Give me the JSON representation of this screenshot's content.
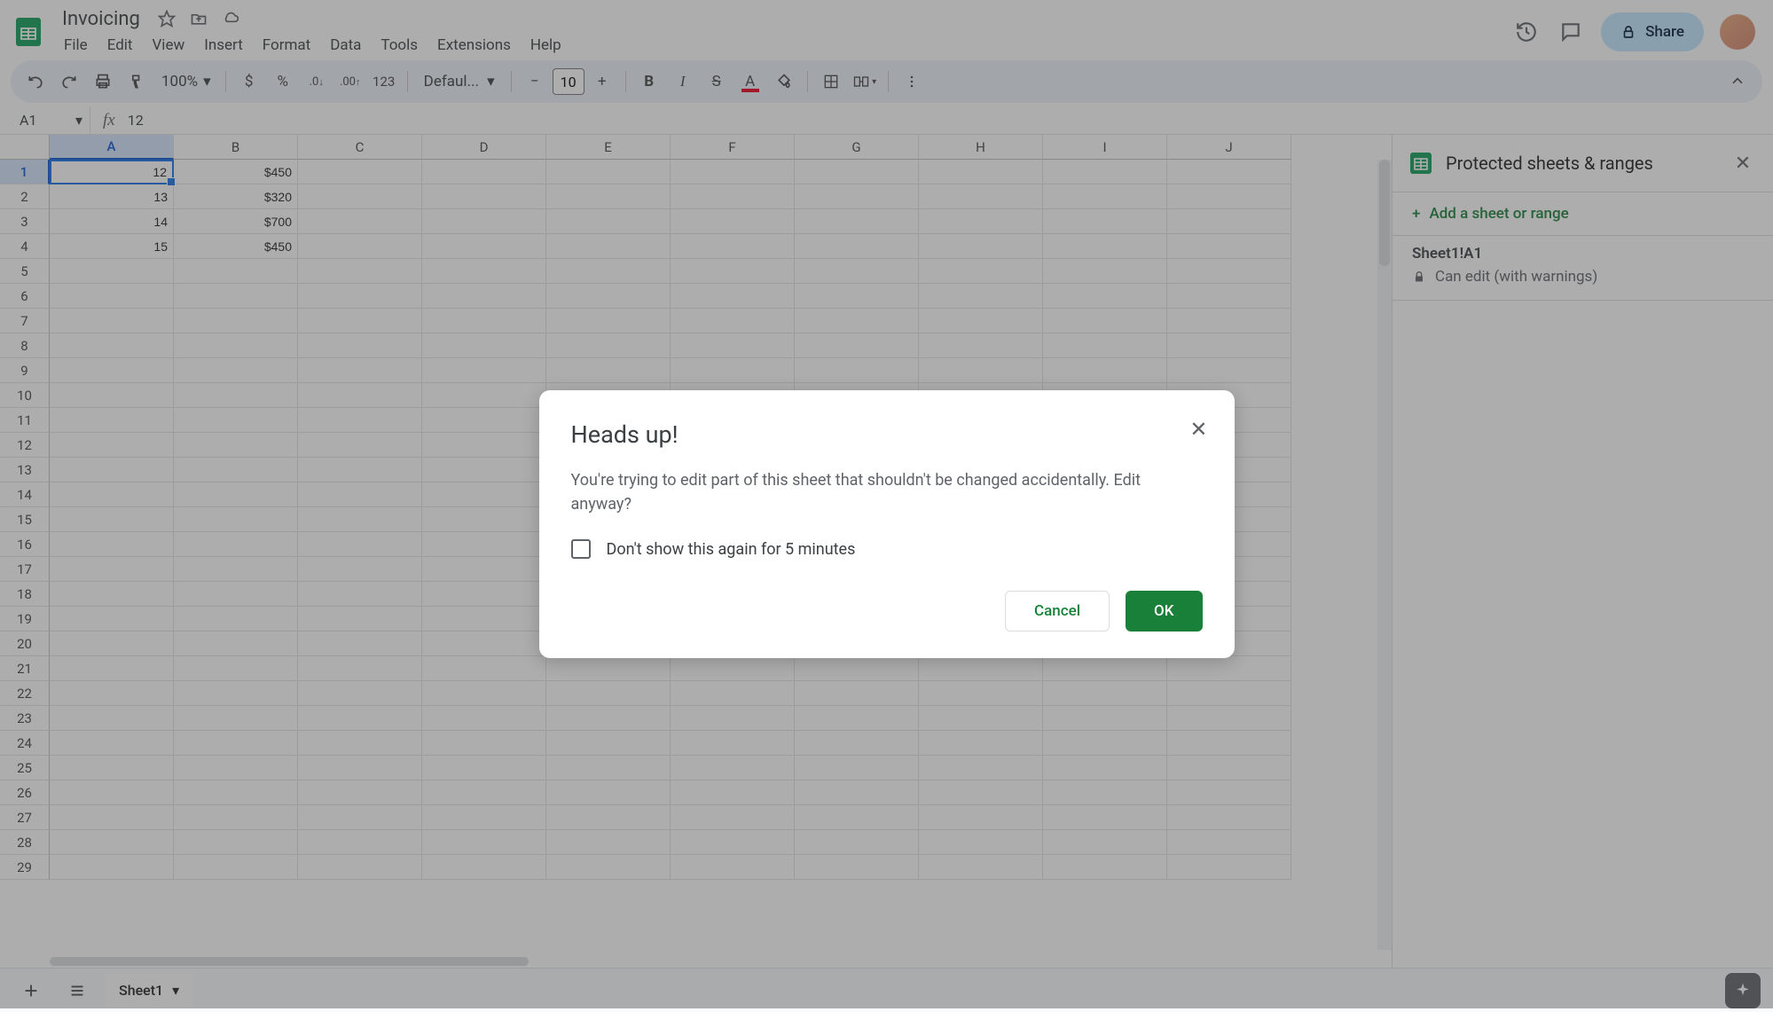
{
  "document": {
    "title": "Invoicing"
  },
  "menubar": [
    "File",
    "Edit",
    "View",
    "Insert",
    "Format",
    "Data",
    "Tools",
    "Extensions",
    "Help"
  ],
  "share": {
    "label": "Share"
  },
  "toolbar": {
    "zoom": "100%",
    "currency": "$",
    "percent": "%",
    "dec_dec": ".0",
    "inc_dec": ".00",
    "num_format": "123",
    "font_name": "Defaul...",
    "font_size": "10"
  },
  "namebox": {
    "value": "A1"
  },
  "formula": {
    "value": "12"
  },
  "columns": [
    "A",
    "B",
    "C",
    "D",
    "E",
    "F",
    "G",
    "H",
    "I",
    "J"
  ],
  "rows": [
    "1",
    "2",
    "3",
    "4",
    "5",
    "6",
    "7",
    "8",
    "9",
    "10",
    "11",
    "12",
    "13",
    "14",
    "15",
    "16",
    "17",
    "18",
    "19",
    "20",
    "21",
    "22",
    "23",
    "24",
    "25",
    "26",
    "27",
    "28",
    "29"
  ],
  "cells": {
    "A1": "12",
    "B1": "$450",
    "A2": "13",
    "B2": "$320",
    "A3": "14",
    "B3": "$700",
    "A4": "15",
    "B4": "$450"
  },
  "sidepanel": {
    "title": "Protected sheets & ranges",
    "add_label": "Add a sheet or range",
    "range_name": "Sheet1!A1",
    "range_perm": "Can edit (with warnings)"
  },
  "bottombar": {
    "sheet_name": "Sheet1"
  },
  "dialog": {
    "title": "Heads up!",
    "body": "You're trying to edit part of this sheet that shouldn't be changed accidentally. Edit anyway?",
    "checkbox_label": "Don't show this again for 5 minutes",
    "cancel": "Cancel",
    "ok": "OK"
  }
}
